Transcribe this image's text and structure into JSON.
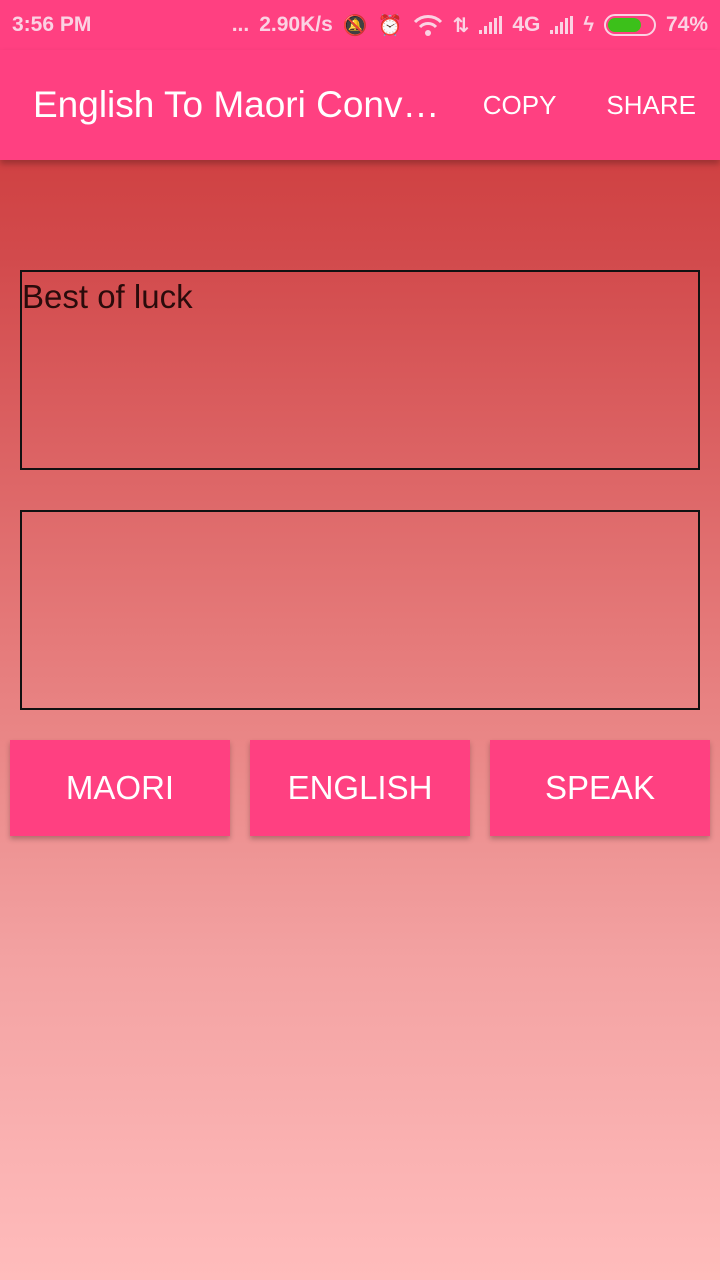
{
  "status_bar": {
    "time": "3:56 PM",
    "dots": "...",
    "network_speed": "2.90K/s",
    "network_type": "4G",
    "battery_percent": "74%",
    "battery_level": 0.74,
    "icons": [
      "notifications-muted-icon",
      "alarm-icon",
      "wifi-icon",
      "data-transfer-icon",
      "signal-icon",
      "signal-icon",
      "charging-icon",
      "battery-icon"
    ]
  },
  "app_bar": {
    "title": "English To Maori Converter",
    "copy_label": "COPY",
    "share_label": "SHARE"
  },
  "main": {
    "input_text": "Best of luck",
    "output_text": ""
  },
  "buttons": {
    "maori_label": "MAORI",
    "english_label": "ENGLISH",
    "speak_label": "SPEAK"
  },
  "colors": {
    "accent": "#ff4081",
    "gradient_top": "#cc3333",
    "gradient_bottom": "#ffbcbc",
    "battery_fill": "#3cc01a"
  }
}
